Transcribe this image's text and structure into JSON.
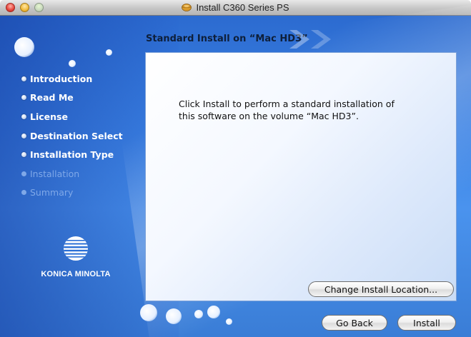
{
  "window": {
    "title": "Install C360 Series PS"
  },
  "heading": "Standard Install on “Mac HD3”",
  "steps": [
    {
      "label": "Introduction",
      "state": "done"
    },
    {
      "label": "Read Me",
      "state": "done"
    },
    {
      "label": "License",
      "state": "done"
    },
    {
      "label": "Destination Select",
      "state": "done"
    },
    {
      "label": "Installation Type",
      "state": "current"
    },
    {
      "label": "Installation",
      "state": "pending"
    },
    {
      "label": "Summary",
      "state": "pending"
    }
  ],
  "logo": {
    "text": "KONICA MINOLTA"
  },
  "content": {
    "line1": "Click Install to perform a standard installation of",
    "line2": "this software on the volume “Mac HD3”."
  },
  "buttons": {
    "change_location": "Change Install Location...",
    "go_back": "Go Back",
    "install": "Install"
  },
  "colors": {
    "background_blue": "#3b82e4",
    "disabled_step": "#7fa8e8"
  }
}
